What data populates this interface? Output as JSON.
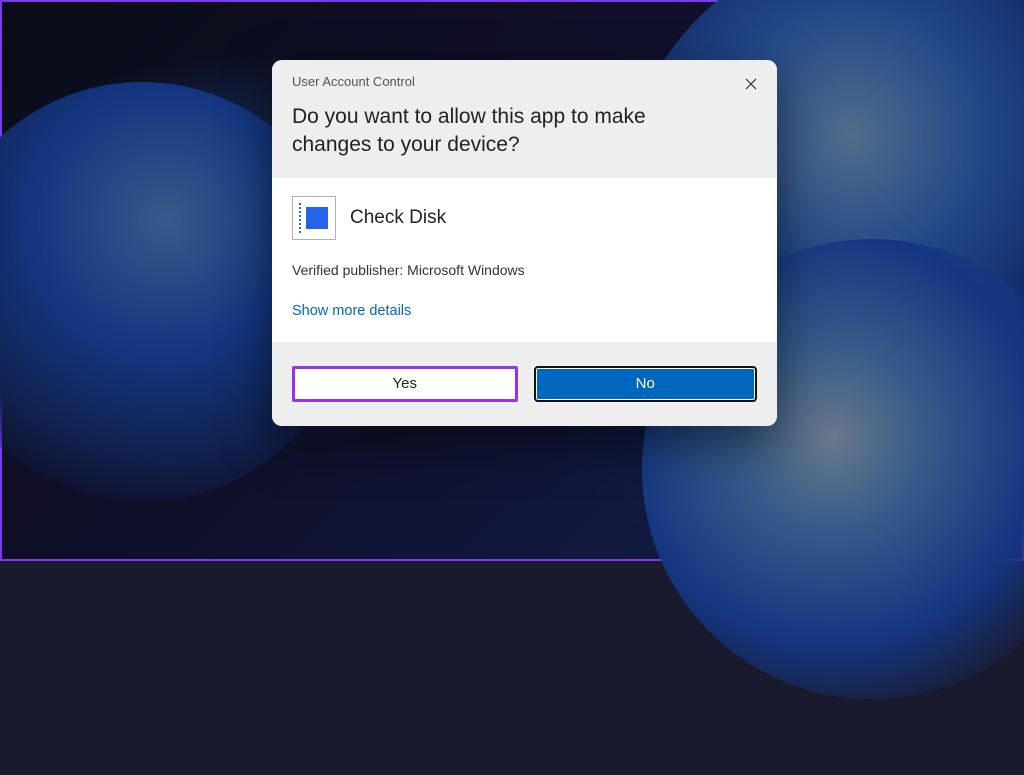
{
  "dialog": {
    "title": "User Account Control",
    "question": "Do you want to allow this app to make changes to your device?",
    "app_name": "Check Disk",
    "publisher_line": "Verified publisher: Microsoft Windows",
    "show_more_label": "Show more details",
    "yes_label": "Yes",
    "no_label": "No"
  }
}
